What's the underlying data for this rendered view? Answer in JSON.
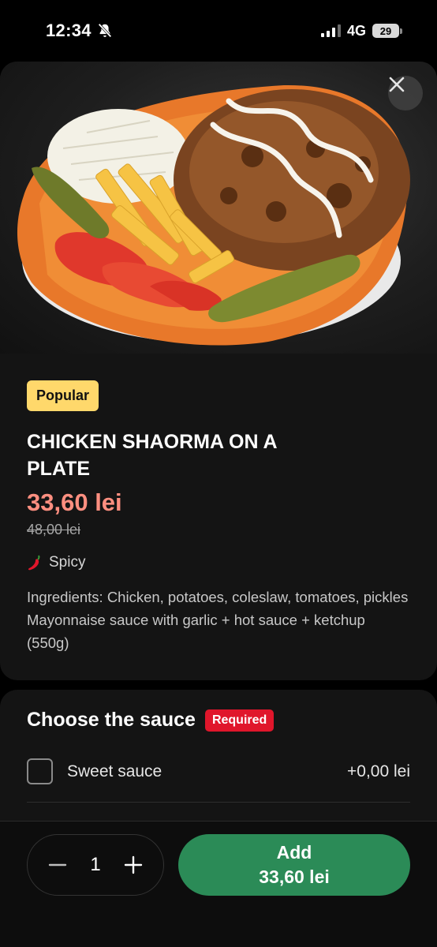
{
  "status_bar": {
    "time": "12:34",
    "network": "4G",
    "battery": "29"
  },
  "product": {
    "badge": "Popular",
    "title": "CHICKEN SHAORMA ON A PLATE",
    "price": "33,60 lei",
    "old_price": "48,00 lei",
    "tag": "Spicy",
    "ingredients": "Ingredients: Chicken, potatoes, coleslaw, tomatoes, pickles Mayonnaise sauce with garlic + hot sauce + ketchup (550g)"
  },
  "sauce": {
    "title": "Choose the sauce",
    "required_label": "Required",
    "options": [
      {
        "label": "Sweet sauce",
        "price": "+0,00 lei",
        "checked": false
      }
    ]
  },
  "cart": {
    "quantity": "1",
    "add_label": "Add",
    "add_price": "33,60 lei"
  },
  "colors": {
    "accent_green": "#2b8b57",
    "price_color": "#ff8f80",
    "badge_popular": "#ffd86b",
    "badge_required": "#e0162b"
  }
}
